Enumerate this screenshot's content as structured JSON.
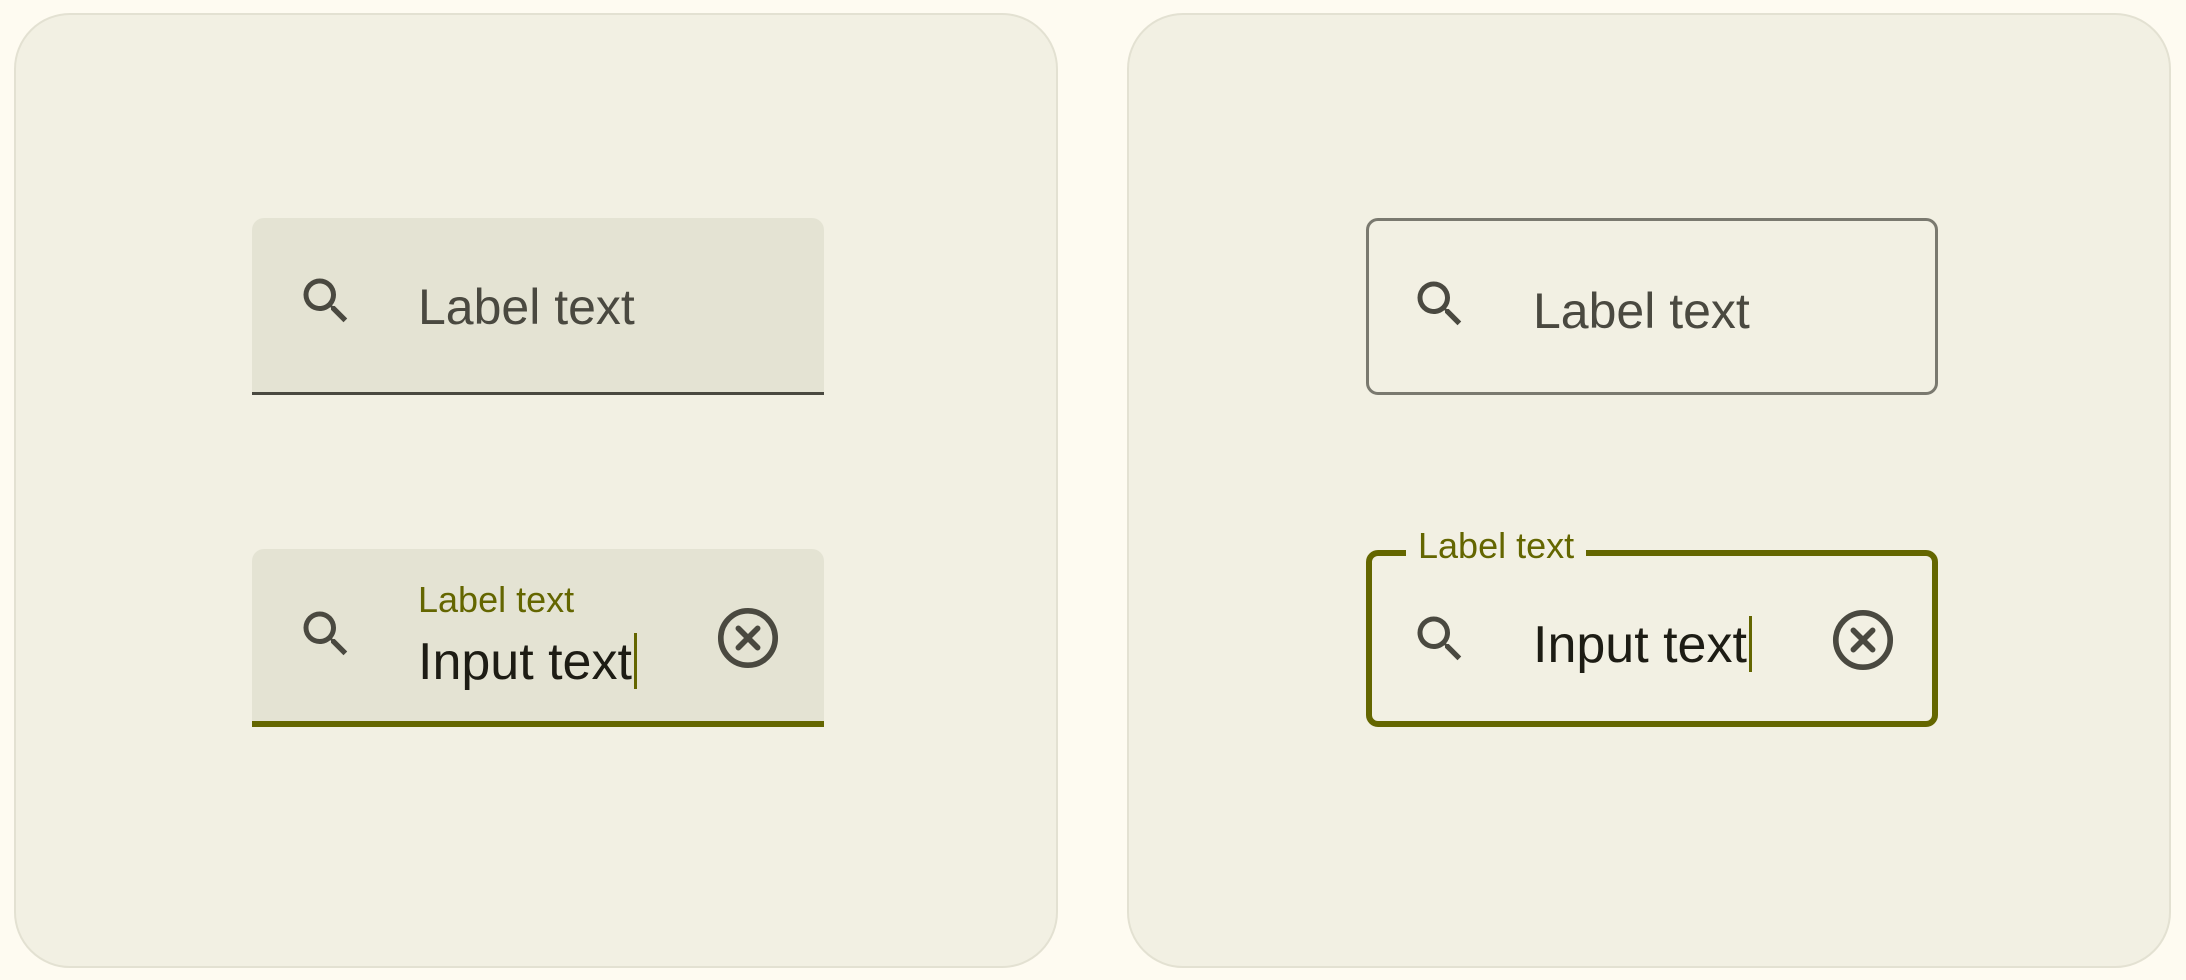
{
  "filled_panel": {
    "empty_field": {
      "label": "Label text",
      "icon": "search-icon"
    },
    "active_field": {
      "label": "Label text",
      "input_value": "Input text",
      "leading_icon": "search-icon",
      "trailing_icon": "clear-icon"
    }
  },
  "outlined_panel": {
    "empty_field": {
      "label": "Label text",
      "icon": "search-icon"
    },
    "active_field": {
      "label": "Label text",
      "input_value": "Input text",
      "leading_icon": "search-icon",
      "trailing_icon": "clear-icon"
    }
  },
  "colors": {
    "page_background": "#fefbf1",
    "panel_background": "#f2f0e3",
    "filled_container": "#e4e3d3",
    "primary_accent": "#646600",
    "on_surface_variant": "#4a4940",
    "outline": "#7a796f"
  }
}
